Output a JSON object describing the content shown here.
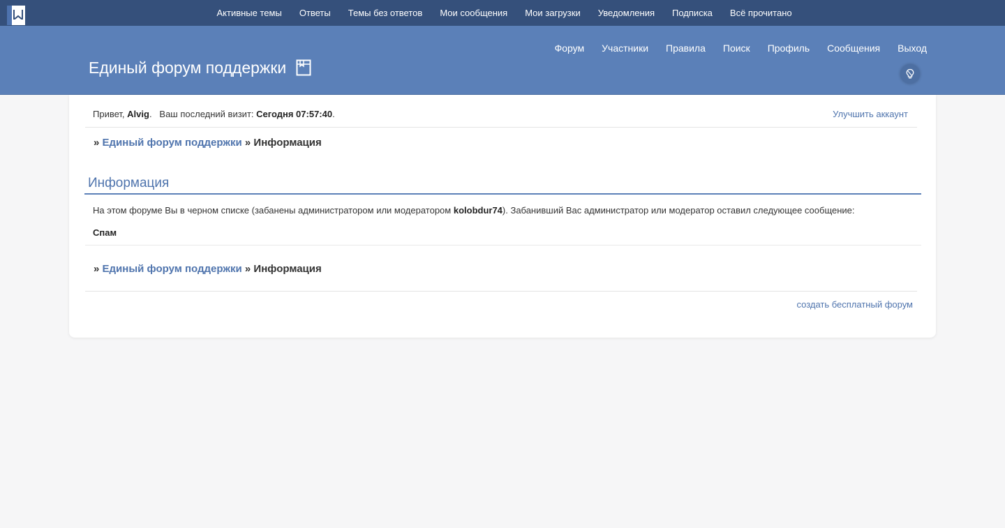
{
  "topbar": {
    "links": [
      "Активные темы",
      "Ответы",
      "Темы без ответов",
      "Мои сообщения",
      "Мои загрузки",
      "Уведомления",
      "Подписка",
      "Всё прочитано"
    ]
  },
  "header": {
    "title": "Единый форум поддержки",
    "nav": [
      "Форум",
      "Участники",
      "Правила",
      "Поиск",
      "Профиль",
      "Сообщения",
      "Выход"
    ]
  },
  "welcome": {
    "greeting": "Привет, ",
    "username": "Alvig",
    "dot": ".",
    "last_visit_label": "Ваш последний визит: ",
    "last_visit_value": "Сегодня 07:57:40",
    "end": ".",
    "upgrade": "Улучшить аккаунт"
  },
  "breadcrumb": {
    "sep": "»",
    "forum": "Единый форум поддержки",
    "current": "Информация"
  },
  "section": {
    "title": "Информация",
    "message_before": "На этом форуме Вы в черном списке (забанены администратором или модератором ",
    "moderator": "kolobdur74",
    "message_after": "). Забанивший Вас администратор или модератор оставил следующее сообщение:",
    "reason": "Спам"
  },
  "footer": {
    "link": "создать бесплатный форум"
  },
  "colors": {
    "topbar": "#35507b",
    "header": "#5b80b8",
    "link": "#4f74ad"
  }
}
